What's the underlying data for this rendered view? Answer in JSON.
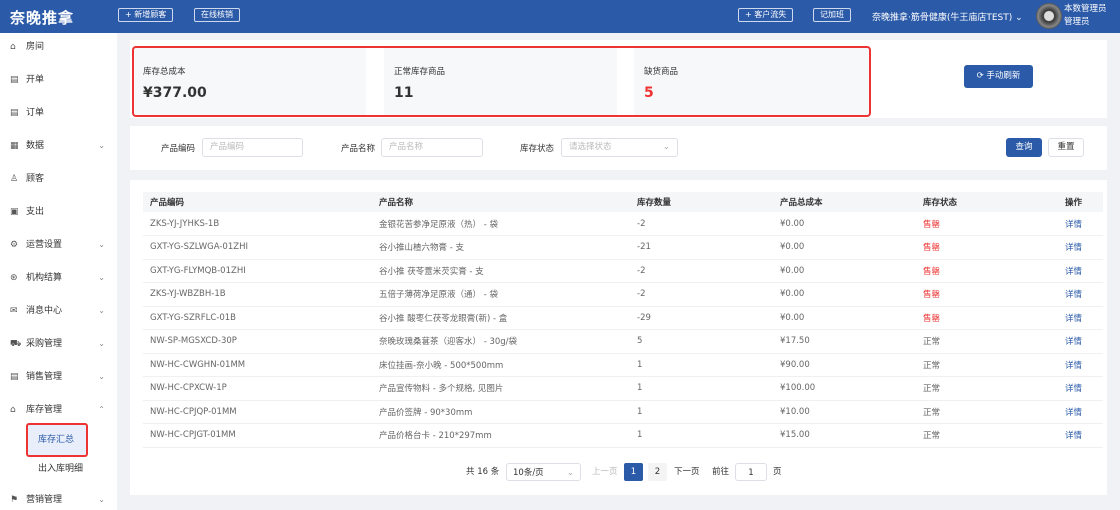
{
  "header": {
    "logo": "奈晚推拿",
    "add_customer": "+ 新增顾客",
    "online_verify": "在线核销",
    "customer_loss": "+ 客户流失",
    "clock_shift": "记加班",
    "store": "奈晚推拿·筋骨健康(牛王庙店TEST)",
    "user_name": "本数管理员",
    "user_role": "管理员"
  },
  "sidebar": {
    "items": [
      {
        "label": "房间",
        "icon": "⌂"
      },
      {
        "label": "开单",
        "icon": "▤"
      },
      {
        "label": "订单",
        "icon": "▤"
      },
      {
        "label": "数据",
        "icon": "▦",
        "chevron": "⌄"
      },
      {
        "label": "顾客",
        "icon": "♙"
      },
      {
        "label": "支出",
        "icon": "▣"
      },
      {
        "label": "运营设置",
        "icon": "⚙",
        "chevron": "⌄"
      },
      {
        "label": "机构结算",
        "icon": "⊛",
        "chevron": "⌄"
      },
      {
        "label": "消息中心",
        "icon": "✉",
        "chevron": "⌄"
      },
      {
        "label": "采购管理",
        "icon": "⛟",
        "chevron": "⌄"
      },
      {
        "label": "销售管理",
        "icon": "▤",
        "chevron": "⌄"
      },
      {
        "label": "库存管理",
        "icon": "⌂",
        "chevron": "⌃"
      }
    ],
    "sub": [
      "库存汇总",
      "出入库明细"
    ],
    "last": {
      "label": "营销管理",
      "icon": "⚑",
      "chevron": "⌄"
    }
  },
  "stats": [
    {
      "label": "库存总成本",
      "value": "¥377.00",
      "color": "#222222"
    },
    {
      "label": "正常库存商品",
      "value": "11",
      "color": "#222222"
    },
    {
      "label": "缺货商品",
      "value": "5",
      "color": "#e33333"
    }
  ],
  "refresh_label": "⟳ 手动刷新",
  "filters": {
    "code_label": "产品编码",
    "code_placeholder": "产品编码",
    "name_label": "产品名称",
    "name_placeholder": "产品名称",
    "status_label": "库存状态",
    "status_placeholder": "请选择状态",
    "query": "查询",
    "reset": "重置"
  },
  "table": {
    "headers": [
      "产品编码",
      "产品名称",
      "库存数量",
      "产品总成本",
      "库存状态",
      "操作"
    ],
    "rows": [
      [
        "ZKS-YJ-JYHKS-1B",
        "金银花苦参净足原液（热） - 袋",
        "-2",
        "¥0.00",
        "售罄",
        "详情"
      ],
      [
        "GXT-YG-SZLWGA-01ZHI",
        "谷小推山楂六物膏 - 支",
        "-21",
        "¥0.00",
        "售罄",
        "详情"
      ],
      [
        "GXT-YG-FLYMQB-01ZHI",
        "谷小推 茯苓薏米芡实膏 - 支",
        "-2",
        "¥0.00",
        "售罄",
        "详情"
      ],
      [
        "ZKS-YJ-WBZBH-1B",
        "五倍子薄荷净足原液（通） - 袋",
        "-2",
        "¥0.00",
        "售罄",
        "详情"
      ],
      [
        "GXT-YG-SZRFLC-01B",
        "谷小推 酸枣仁茯苓龙眼膏(新) - 盒",
        "-29",
        "¥0.00",
        "售罄",
        "详情"
      ],
      [
        "NW-SP-MGSXCD-30P",
        "奈晚玫瑰桑葚茶（迎客水） - 30g/袋",
        "5",
        "¥17.50",
        "正常",
        "详情"
      ],
      [
        "NW-HC-CWGHN-01MM",
        "床位挂画-奈小晚 - 500*500mm",
        "1",
        "¥90.00",
        "正常",
        "详情"
      ],
      [
        "NW-HC-CPXCW-1P",
        "产品宣传物料 - 多个规格, 见图片",
        "1",
        "¥100.00",
        "正常",
        "详情"
      ],
      [
        "NW-HC-CPJQP-01MM",
        "产品价签牌 - 90*30mm",
        "1",
        "¥10.00",
        "正常",
        "详情"
      ],
      [
        "NW-HC-CPJGT-01MM",
        "产品价格台卡 - 210*297mm",
        "1",
        "¥15.00",
        "正常",
        "详情"
      ]
    ]
  },
  "pagination": {
    "total": "共 16 条",
    "page_size": "10条/页",
    "prev": "上一页",
    "pages": [
      "1",
      "2"
    ],
    "next": "下一页",
    "goto": "前往",
    "goto_value": "1",
    "page_unit": "页"
  }
}
